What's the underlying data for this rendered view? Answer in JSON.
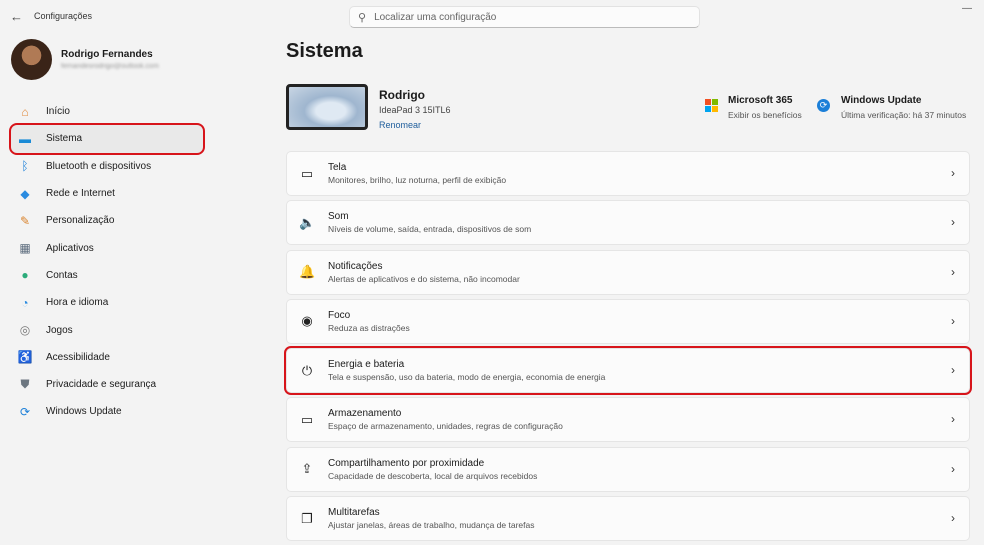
{
  "window": {
    "title": "Configurações",
    "back": "←",
    "controls": "—"
  },
  "search": {
    "placeholder": "Localizar uma configuração",
    "icon": "search-icon"
  },
  "profile": {
    "name": "Rodrigo Fernandes",
    "email": "fernandesrodrigo@outlook.com"
  },
  "sidebar": {
    "items": [
      {
        "label": "Início",
        "icon": "home-icon",
        "glyph": "⌂",
        "color": "#e08a3c"
      },
      {
        "label": "Sistema",
        "icon": "system-icon",
        "glyph": "▬",
        "color": "#1b8bd6",
        "selected": true
      },
      {
        "label": "Bluetooth e dispositivos",
        "icon": "bluetooth-icon",
        "glyph": "ᛒ",
        "color": "#1b7fd8"
      },
      {
        "label": "Rede e Internet",
        "icon": "wifi-icon",
        "glyph": "◆",
        "color": "#2a8be0"
      },
      {
        "label": "Personalização",
        "icon": "brush-icon",
        "glyph": "✎",
        "color": "#d9822b"
      },
      {
        "label": "Aplicativos",
        "icon": "apps-icon",
        "glyph": "▦",
        "color": "#5b6b7c"
      },
      {
        "label": "Contas",
        "icon": "accounts-icon",
        "glyph": "●",
        "color": "#2bab7a"
      },
      {
        "label": "Hora e idioma",
        "icon": "globe-clock-icon",
        "glyph": "◔",
        "color": "#2a8be0"
      },
      {
        "label": "Jogos",
        "icon": "gamepad-icon",
        "glyph": "◎",
        "color": "#777"
      },
      {
        "label": "Acessibilidade",
        "icon": "accessibility-icon",
        "glyph": "♿",
        "color": "#1b7fd8"
      },
      {
        "label": "Privacidade e segurança",
        "icon": "shield-icon",
        "glyph": "⛊",
        "color": "#6c7680"
      },
      {
        "label": "Windows Update",
        "icon": "update-icon",
        "glyph": "⟳",
        "color": "#1b7fd8"
      }
    ]
  },
  "main": {
    "title": "Sistema",
    "device": {
      "name": "Rodrigo",
      "model": "IdeaPad 3 15ITL6",
      "rename": "Renomear"
    },
    "promos": [
      {
        "title": "Microsoft 365",
        "subtitle": "Exibir os benefícios"
      },
      {
        "title": "Windows Update",
        "subtitle": "Última verificação: há 37 minutos"
      }
    ],
    "cards": [
      {
        "title": "Tela",
        "subtitle": "Monitores, brilho, luz noturna, perfil de exibição",
        "icon": "display-icon",
        "glyph": "▭"
      },
      {
        "title": "Som",
        "subtitle": "Níveis de volume, saída, entrada, dispositivos de som",
        "icon": "speaker-icon",
        "glyph": "🔈"
      },
      {
        "title": "Notificações",
        "subtitle": "Alertas de aplicativos e do sistema, não incomodar",
        "icon": "bell-icon",
        "glyph": "🔔"
      },
      {
        "title": "Foco",
        "subtitle": "Reduza as distrações",
        "icon": "focus-icon",
        "glyph": "◉"
      },
      {
        "title": "Energia e bateria",
        "subtitle": "Tela e suspensão, uso da bateria, modo de energia, economia de energia",
        "icon": "power-icon",
        "glyph": "⏻",
        "highlighted": true
      },
      {
        "title": "Armazenamento",
        "subtitle": "Espaço de armazenamento, unidades, regras de configuração",
        "icon": "storage-icon",
        "glyph": "▭"
      },
      {
        "title": "Compartilhamento por proximidade",
        "subtitle": "Capacidade de descoberta, local de arquivos recebidos",
        "icon": "share-icon",
        "glyph": "⇪"
      },
      {
        "title": "Multitarefas",
        "subtitle": "Ajustar janelas, áreas de trabalho, mudança de tarefas",
        "icon": "multitask-icon",
        "glyph": "❐"
      }
    ]
  }
}
